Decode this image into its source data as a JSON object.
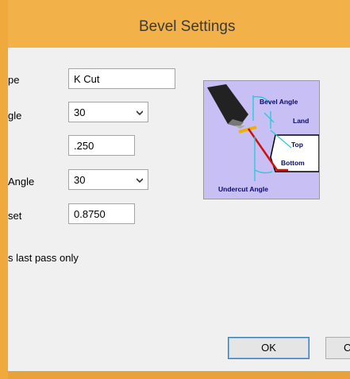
{
  "window": {
    "title": "Bevel Settings"
  },
  "form": {
    "type_label": "pe",
    "type_value": "K Cut",
    "angle_label": "gle",
    "angle_value": "30",
    "land_value": ".250",
    "undercut_label": "Angle",
    "undercut_value": "30",
    "offset_label": "set",
    "offset_value": "0.8750",
    "checkbox_label": "s last pass only"
  },
  "diagram": {
    "bevel_angle": "Bevel Angle",
    "land": "Land",
    "top": "Top",
    "bottom": "Bottom",
    "undercut_angle": "Undercut Angle"
  },
  "buttons": {
    "ok": "OK",
    "cancel_partial": "C"
  },
  "colors": {
    "titlebar": "#f3b14a",
    "client": "#f0f0f0",
    "diagram_bg": "#c8bff5",
    "cut_line": "#d01010",
    "guide": "#2ec8d8"
  }
}
